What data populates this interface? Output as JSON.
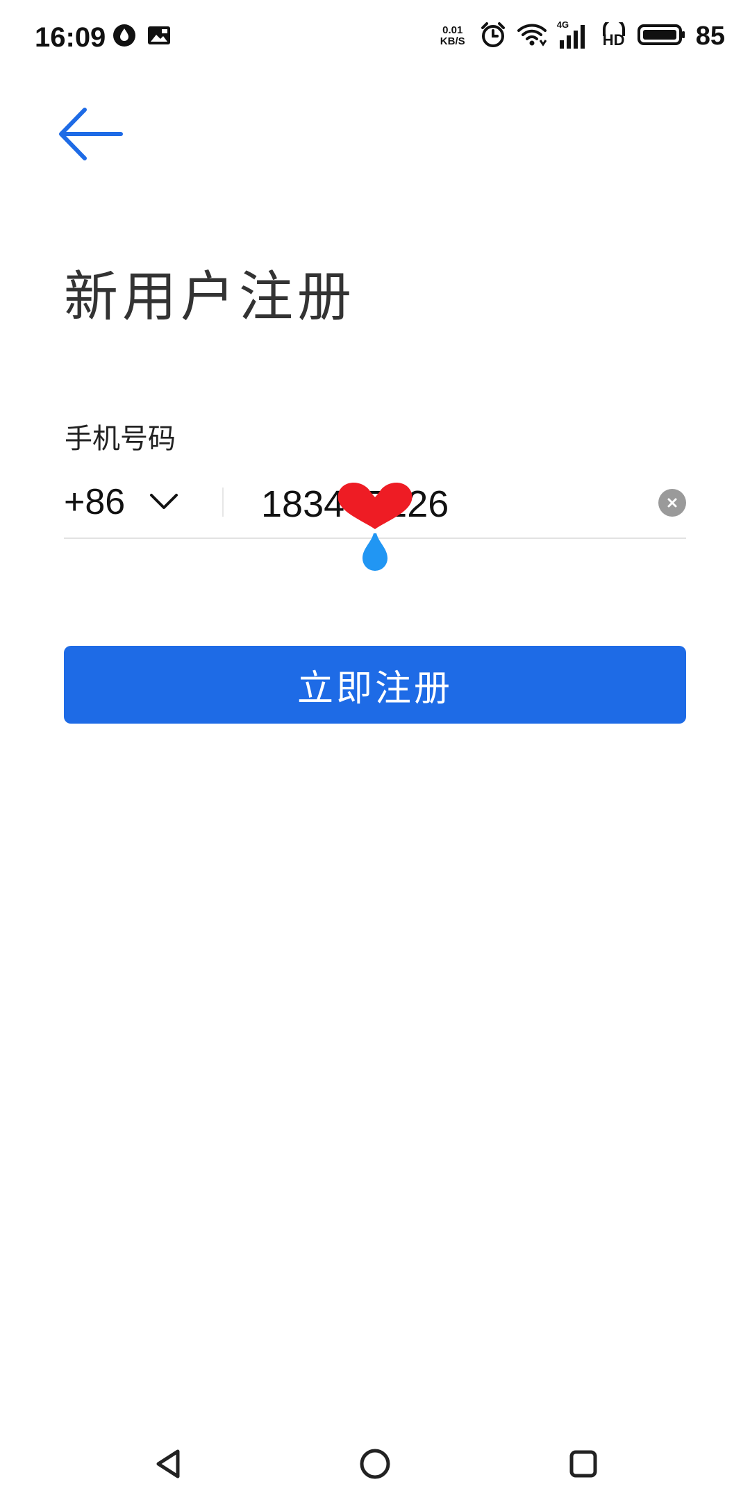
{
  "status_bar": {
    "time": "16:09",
    "net_speed_value": "0.01",
    "net_speed_unit": "KB/S",
    "signal_type": "4G",
    "hd_label": "HD",
    "battery": "85",
    "icons": [
      "drop-notification-icon",
      "image-notification-icon",
      "alarm-icon",
      "wifi-icon",
      "cellular-signal-icon",
      "hd-voice-icon",
      "battery-icon"
    ]
  },
  "header": {
    "back_icon": "arrow-left-icon",
    "title": "新用户注册"
  },
  "form": {
    "phone_label": "手机号码",
    "country_code": "+86",
    "phone_value": "1834  5126",
    "clear_icon": "clear-icon"
  },
  "actions": {
    "register_label": "立即注册"
  },
  "colors": {
    "accent": "#1e6be6",
    "title_text": "#333333",
    "divider": "#e2e2e2",
    "clear_button": "#9a9a9a",
    "sticker_heart": "#ee1c24",
    "sticker_drop": "#2196f3"
  },
  "nav_bar": {
    "icons": [
      "nav-back-icon",
      "nav-home-icon",
      "nav-recents-icon"
    ]
  }
}
